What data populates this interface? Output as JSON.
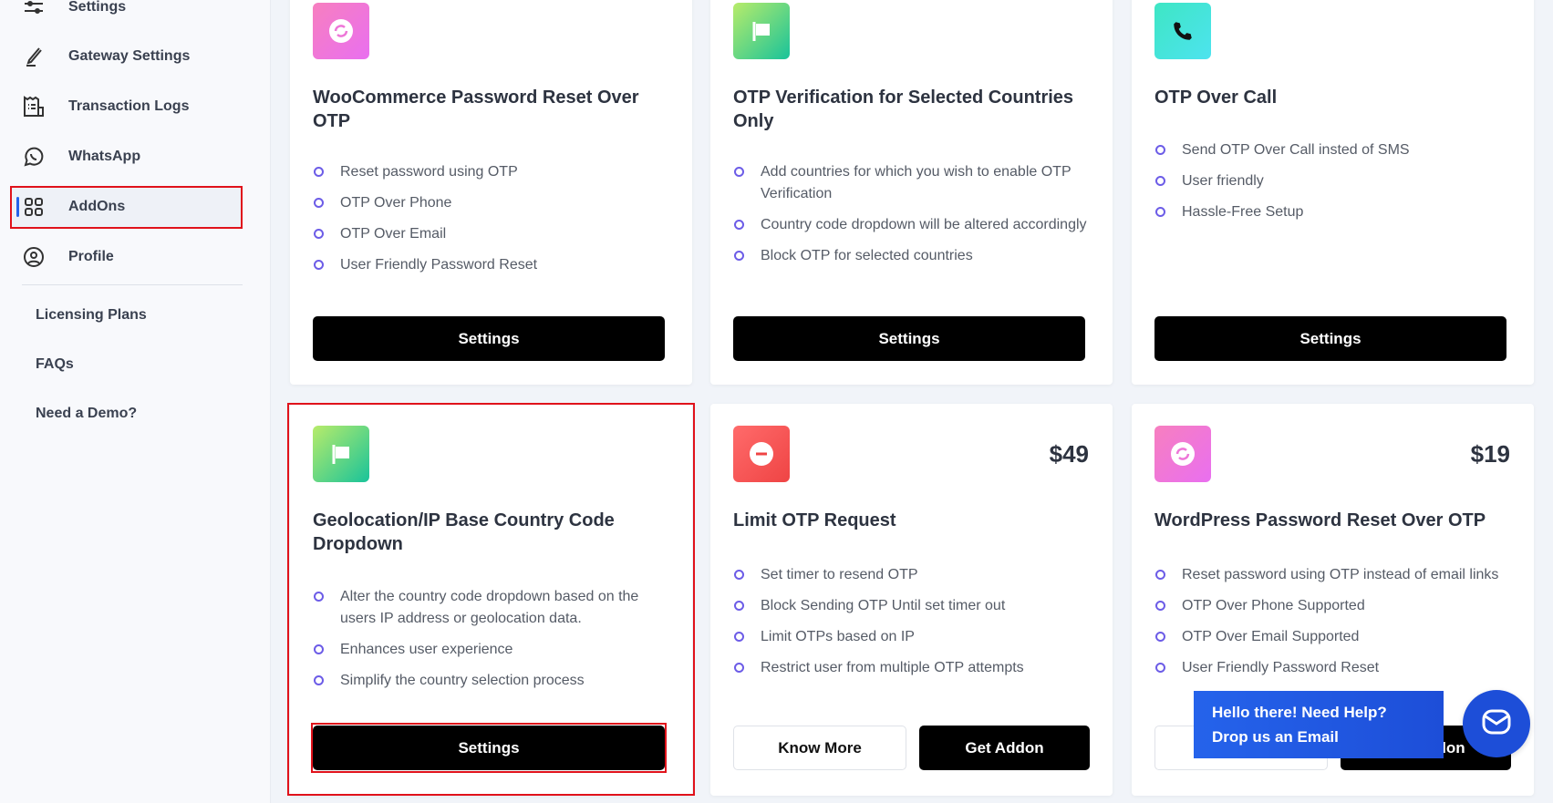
{
  "sidebar": {
    "items": [
      {
        "label": "Settings",
        "icon": "sliders-icon"
      },
      {
        "label": "Gateway Settings",
        "icon": "pen-icon"
      },
      {
        "label": "Transaction Logs",
        "icon": "receipt-icon"
      },
      {
        "label": "WhatsApp",
        "icon": "whatsapp-icon"
      },
      {
        "label": "AddOns",
        "icon": "grid-icon",
        "active": true
      },
      {
        "label": "Profile",
        "icon": "user-circle-icon"
      }
    ],
    "links": [
      "Licensing Plans",
      "FAQs",
      "Need a Demo?"
    ],
    "accent": "#2563eb"
  },
  "addons": [
    {
      "title": "WooCommerce Password Reset Over OTP",
      "icon": "refresh-icon",
      "features": [
        "Reset password using OTP",
        "OTP Over Phone",
        "OTP Over Email",
        "User Friendly Password Reset"
      ],
      "button": "Settings"
    },
    {
      "title": "OTP Verification for Selected Countries Only",
      "icon": "flag-icon",
      "features": [
        "Add countries for which you wish to enable OTP Verification",
        "Country code dropdown will be altered accordingly",
        "Block OTP for selected countries"
      ],
      "button": "Settings"
    },
    {
      "title": "OTP Over Call",
      "icon": "phone-icon",
      "features": [
        "Send OTP Over Call insted of SMS",
        "User friendly",
        "Hassle-Free Setup"
      ],
      "button": "Settings"
    },
    {
      "title": "Geolocation/IP Base Country Code Dropdown",
      "icon": "flag-icon",
      "features": [
        "Alter the country code dropdown based on the users IP address or geolocation data.",
        "Enhances user experience",
        "Simplify the country selection process"
      ],
      "button": "Settings"
    },
    {
      "title": "Limit OTP Request",
      "icon": "minus-circle-icon",
      "price": "$49",
      "features": [
        "Set timer to resend OTP",
        "Block Sending OTP Until set timer out",
        "Limit OTPs based on IP",
        "Restrict user from multiple OTP attempts"
      ],
      "know_more": "Know More",
      "get": "Get Addon"
    },
    {
      "title": "WordPress Password Reset Over OTP",
      "icon": "refresh-icon",
      "price": "$19",
      "features": [
        "Reset password using OTP instead of email links",
        "OTP Over Phone Supported",
        "OTP Over Email Supported",
        "User Friendly Password Reset"
      ],
      "know_more": "Know More",
      "get": "Get Addon"
    }
  ],
  "chat": {
    "line1": "Hello there! Need Help?",
    "line2": "Drop us an Email",
    "color": "#1d4ed8"
  }
}
